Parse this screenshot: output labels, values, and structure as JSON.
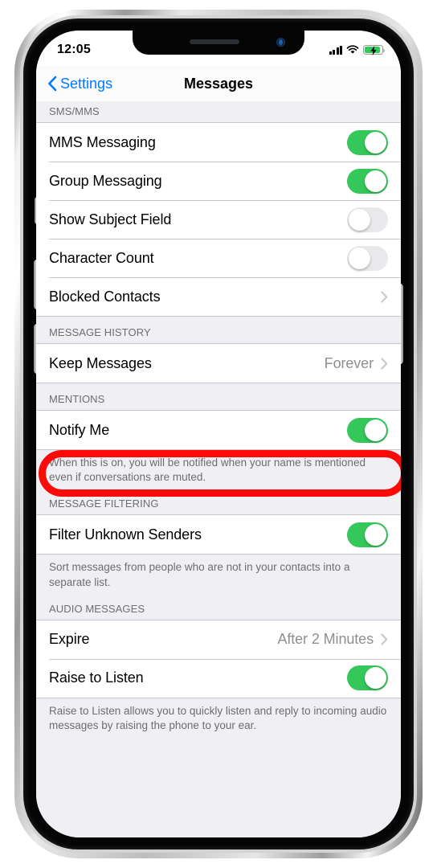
{
  "status_bar": {
    "time": "12:05",
    "signal_icon": "cellular-signal-icon",
    "wifi_icon": "wifi-icon",
    "battery_icon": "battery-charging-icon"
  },
  "nav": {
    "back_label": "Settings",
    "back_icon": "chevron-left-icon",
    "title": "Messages"
  },
  "colors": {
    "accent_blue": "#007AFF",
    "toggle_on_green": "#34C759",
    "toggle_off_gray": "#E9E9EB",
    "annotation_red": "#FA0B08",
    "group_bg": "#EFEFF4",
    "secondary_text": "#8E8E93",
    "header_text": "#6D6D72"
  },
  "sections": [
    {
      "header": "SMS/MMS",
      "rows": [
        {
          "label": "MMS Messaging",
          "control": "toggle",
          "on": true
        },
        {
          "label": "Group Messaging",
          "control": "toggle",
          "on": true
        },
        {
          "label": "Show Subject Field",
          "control": "toggle",
          "on": false
        },
        {
          "label": "Character Count",
          "control": "toggle",
          "on": false
        },
        {
          "label": "Blocked Contacts",
          "control": "disclosure",
          "value": ""
        }
      ],
      "footer": ""
    },
    {
      "header": "MESSAGE HISTORY",
      "rows": [
        {
          "label": "Keep Messages",
          "control": "disclosure",
          "value": "Forever",
          "highlighted": true
        }
      ],
      "footer": ""
    },
    {
      "header": "MENTIONS",
      "rows": [
        {
          "label": "Notify Me",
          "control": "toggle",
          "on": true
        }
      ],
      "footer": "When this is on, you will be notified when your name is mentioned even if conversations are muted."
    },
    {
      "header": "MESSAGE FILTERING",
      "rows": [
        {
          "label": "Filter Unknown Senders",
          "control": "toggle",
          "on": true
        }
      ],
      "footer": "Sort messages from people who are not in your contacts into a separate list."
    },
    {
      "header": "AUDIO MESSAGES",
      "rows": [
        {
          "label": "Expire",
          "control": "disclosure",
          "value": "After 2 Minutes"
        },
        {
          "label": "Raise to Listen",
          "control": "toggle",
          "on": true
        }
      ],
      "footer": "Raise to Listen allows you to quickly listen and reply to incoming audio messages by raising the phone to your ear."
    }
  ],
  "annotation": {
    "type": "red-oval-highlight",
    "target_row_label": "Keep Messages"
  }
}
